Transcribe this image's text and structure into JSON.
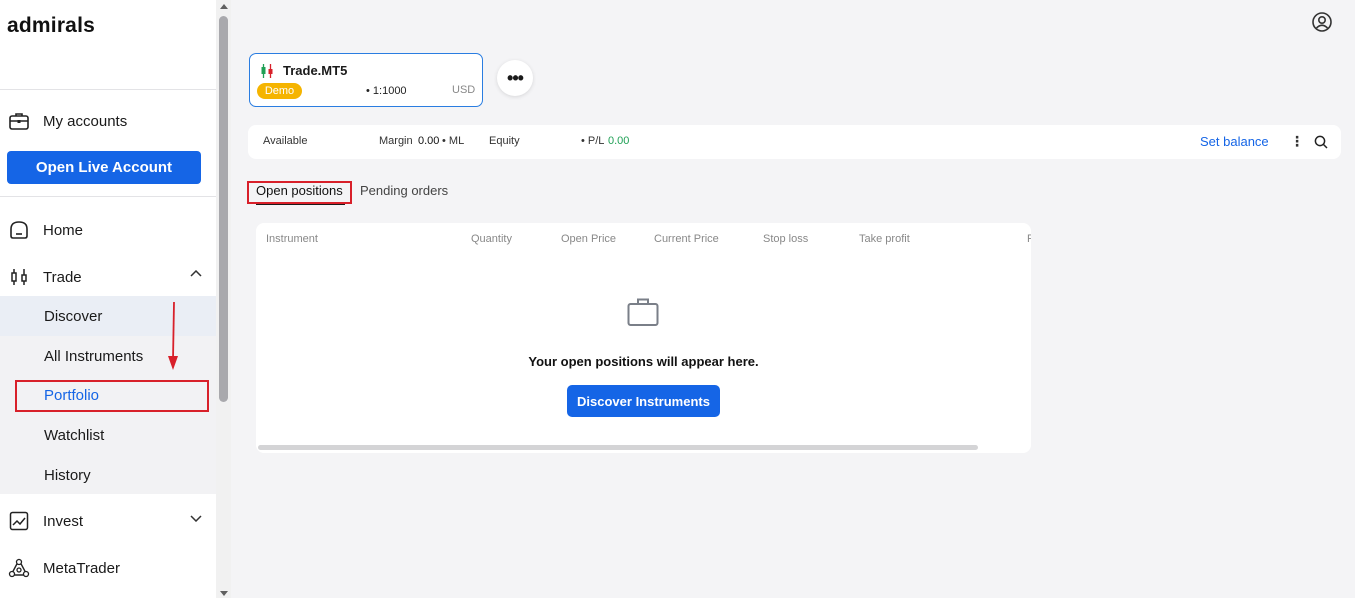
{
  "brand": {
    "logo": "admirals"
  },
  "sidebar": {
    "my_accounts": "My accounts",
    "open_live": "Open Live Account",
    "home": "Home",
    "trade": "Trade",
    "trade_sub": [
      "Discover",
      "All Instruments",
      "Portfolio",
      "Watchlist",
      "History"
    ],
    "invest": "Invest",
    "metatrader": "MetaTrader"
  },
  "account": {
    "name": "Trade.MT5",
    "badge": "Demo",
    "leverage": "• 1:1000",
    "currency": "USD"
  },
  "stats": {
    "available_label": "Available",
    "margin_label": "Margin",
    "margin_value": "0.00",
    "ml_label": "• ML",
    "equity_label": "Equity",
    "pl_label": "• P/L",
    "pl_value": "0.00",
    "set_balance": "Set balance"
  },
  "tabs": {
    "open": "Open positions",
    "pending": "Pending orders"
  },
  "table": {
    "columns": [
      "Instrument",
      "Quantity",
      "Open Price",
      "Current Price",
      "Stop loss",
      "Take profit",
      "P"
    ]
  },
  "empty_state": {
    "message": "Your open positions will appear here.",
    "button": "Discover Instruments"
  },
  "colors": {
    "accent": "#1565e6",
    "badge": "#f5b400",
    "highlight": "#d8202a",
    "positive": "#1fa055"
  }
}
